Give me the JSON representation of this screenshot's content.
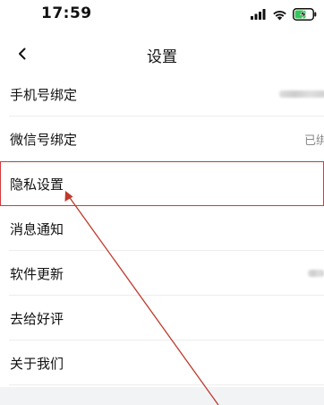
{
  "status_bar": {
    "time": "17:59",
    "icons": [
      "signal-icon",
      "wifi-icon",
      "battery-charging-icon"
    ]
  },
  "nav": {
    "back_icon": "chevron-left-icon",
    "title": "设置"
  },
  "settings": {
    "items": [
      {
        "label": "手机号绑定",
        "value": ""
      },
      {
        "label": "微信号绑定",
        "value": "已绑"
      },
      {
        "label": "隐私设置",
        "value": ""
      },
      {
        "label": "消息通知",
        "value": ""
      },
      {
        "label": "软件更新",
        "value": ""
      },
      {
        "label": "去给好评",
        "value": ""
      },
      {
        "label": "关于我们",
        "value": ""
      }
    ]
  },
  "colors": {
    "highlight": "#d23a3a",
    "arrow": "#c0392b",
    "divider": "#ededed",
    "footer_gray": "#f2f3f5"
  }
}
